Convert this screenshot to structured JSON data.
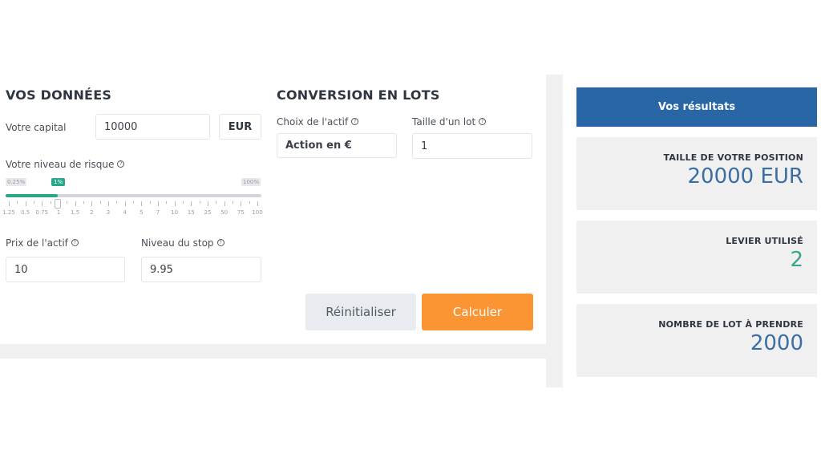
{
  "vos_donnees": {
    "title": "VOS DONNÉES",
    "capital_label": "Votre capital",
    "capital_value": "10000",
    "currency": "EUR",
    "risk_label": "Votre niveau de risque",
    "risk_slider": {
      "min_badge": "0.25%",
      "max_badge": "100%",
      "value_badge": "1%",
      "value_percent": 1,
      "ticks": [
        "1.25",
        "0.5",
        "0.75",
        "1",
        "1.5",
        "2",
        "3",
        "4",
        "5",
        "7",
        "10",
        "15",
        "25",
        "50",
        "75",
        "100"
      ]
    },
    "prix_label": "Prix de l'actif",
    "prix_value": "10",
    "stop_label": "Niveau du stop",
    "stop_value": "9.95"
  },
  "conversion": {
    "title": "CONVERSION EN LOTS",
    "actif_label": "Choix de l'actif",
    "actif_value": "Action en €",
    "lot_label": "Taille d'un lot",
    "lot_value": "1"
  },
  "buttons": {
    "reset": "Réinitialiser",
    "calculate": "Calculer"
  },
  "results": {
    "header": "Vos résultats",
    "cards": [
      {
        "title": "TAILLE DE VOTRE POSITION",
        "value": "20000 EUR"
      },
      {
        "title": "LEVIER UTILISÉ",
        "value": "2"
      },
      {
        "title": "NOMBRE DE LOT À PRENDRE",
        "value": "2000"
      }
    ]
  },
  "colors": {
    "accent_green": "#2aa68a",
    "results_blue": "#2866a5",
    "calculate_orange": "#fb9433"
  }
}
